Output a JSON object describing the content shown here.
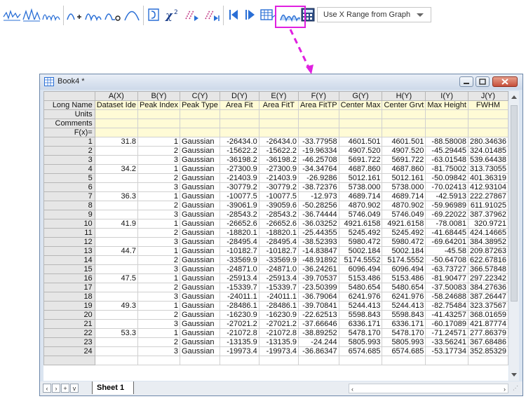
{
  "toolbar": {
    "range_select": {
      "value": "Use X Range from Graph"
    },
    "buttons": [
      "stack-lines-icon",
      "stack-peaks-icon",
      "baseline-peaks-icon",
      "add-peak-icon",
      "peak-shape-icon",
      "remove-peak-icon",
      "peak-bell-icon",
      "integrate-icon",
      "chi-square-icon",
      "fit-until-converge-icon",
      "fit-one-iteration-icon",
      "prev-icon",
      "next-icon",
      "table-icon",
      "find-peaks-icon",
      "calculator-icon"
    ],
    "highlight_color": "#e020e0"
  },
  "window": {
    "title": "Book4 *",
    "sheet_tab": "Sheet 1"
  },
  "columns": [
    "A(X)",
    "B(Y)",
    "C(Y)",
    "D(Y)",
    "E(Y)",
    "F(Y)",
    "G(Y)",
    "H(Y)",
    "I(Y)",
    "J(Y)"
  ],
  "long_names": [
    "Dataset Ide",
    "Peak Index",
    "Peak Type",
    "Area Fit",
    "Area FitT",
    "Area FitTP",
    "Center Max",
    "Center Grvt",
    "Max Height",
    "FWHM"
  ],
  "meta_labels": {
    "long_name": "Long Name",
    "units": "Units",
    "comments": "Comments",
    "fx": "F(x)="
  },
  "rows": [
    [
      "1",
      "31.8",
      "1",
      "Gaussian",
      "-26434.0",
      "-26434.0",
      "-33.77958",
      "4601.501",
      "4601.501",
      "-88.58008",
      "280.34636"
    ],
    [
      "2",
      "",
      "2",
      "Gaussian",
      "-15622.2",
      "-15622.2",
      "-19.96334",
      "4907.520",
      "4907.520",
      "-45.29445",
      "324.01485"
    ],
    [
      "3",
      "",
      "3",
      "Gaussian",
      "-36198.2",
      "-36198.2",
      "-46.25708",
      "5691.722",
      "5691.722",
      "-63.01548",
      "539.64438"
    ],
    [
      "4",
      "34.2",
      "1",
      "Gaussian",
      "-27300.9",
      "-27300.9",
      "-34.34764",
      "4687.860",
      "4687.860",
      "-81.75002",
      "313.73055"
    ],
    [
      "5",
      "",
      "2",
      "Gaussian",
      "-21403.9",
      "-21403.9",
      "-26.9286",
      "5012.161",
      "5012.161",
      "-50.09842",
      "401.36319"
    ],
    [
      "6",
      "",
      "3",
      "Gaussian",
      "-30779.2",
      "-30779.2",
      "-38.72376",
      "5738.000",
      "5738.000",
      "-70.02413",
      "412.93104"
    ],
    [
      "7",
      "36.3",
      "1",
      "Gaussian",
      "-10077.5",
      "-10077.5",
      "-12.973",
      "4689.714",
      "4689.714",
      "-42.5913",
      "222.27867"
    ],
    [
      "8",
      "",
      "2",
      "Gaussian",
      "-39061.9",
      "-39059.6",
      "-50.28256",
      "4870.902",
      "4870.902",
      "-59.96989",
      "611.91025"
    ],
    [
      "9",
      "",
      "3",
      "Gaussian",
      "-28543.2",
      "-28543.2",
      "-36.74444",
      "5746.049",
      "5746.049",
      "-69.22022",
      "387.37962"
    ],
    [
      "10",
      "41.9",
      "1",
      "Gaussian",
      "-26652.6",
      "-26652.6",
      "-36.03252",
      "4921.6158",
      "4921.6158",
      "-78.0081",
      "320.9721"
    ],
    [
      "11",
      "",
      "2",
      "Gaussian",
      "-18820.1",
      "-18820.1",
      "-25.44355",
      "5245.492",
      "5245.492",
      "-41.68445",
      "424.14665"
    ],
    [
      "12",
      "",
      "3",
      "Gaussian",
      "-28495.4",
      "-28495.4",
      "-38.52393",
      "5980.472",
      "5980.472",
      "-69.64201",
      "384.38952"
    ],
    [
      "13",
      "44.7",
      "1",
      "Gaussian",
      "-10182.7",
      "-10182.7",
      "-14.83847",
      "5002.184",
      "5002.184",
      "-45.58",
      "209.87263"
    ],
    [
      "14",
      "",
      "2",
      "Gaussian",
      "-33569.9",
      "-33569.9",
      "-48.91892",
      "5174.5552",
      "5174.5552",
      "-50.64708",
      "622.67816"
    ],
    [
      "15",
      "",
      "3",
      "Gaussian",
      "-24871.0",
      "-24871.0",
      "-36.24261",
      "6096.494",
      "6096.494",
      "-63.73727",
      "366.57848"
    ],
    [
      "16",
      "47.5",
      "1",
      "Gaussian",
      "-25913.4",
      "-25913.4",
      "-39.70537",
      "5153.486",
      "5153.486",
      "-81.90477",
      "297.22342"
    ],
    [
      "17",
      "",
      "2",
      "Gaussian",
      "-15339.7",
      "-15339.7",
      "-23.50399",
      "5480.654",
      "5480.654",
      "-37.50083",
      "384.27636"
    ],
    [
      "18",
      "",
      "3",
      "Gaussian",
      "-24011.1",
      "-24011.1",
      "-36.79064",
      "6241.976",
      "6241.976",
      "-58.24688",
      "387.26447"
    ],
    [
      "19",
      "49.3",
      "1",
      "Gaussian",
      "-28486.1",
      "-28486.1",
      "-39.70841",
      "5244.413",
      "5244.413",
      "-82.75484",
      "323.37567"
    ],
    [
      "20",
      "",
      "2",
      "Gaussian",
      "-16230.9",
      "-16230.9",
      "-22.62513",
      "5598.843",
      "5598.843",
      "-41.43257",
      "368.01659"
    ],
    [
      "21",
      "",
      "3",
      "Gaussian",
      "-27021.2",
      "-27021.2",
      "-37.66646",
      "6336.171",
      "6336.171",
      "-60.17089",
      "421.87774"
    ],
    [
      "22",
      "53.3",
      "1",
      "Gaussian",
      "-21072.8",
      "-21072.8",
      "-38.89252",
      "5478.170",
      "5478.170",
      "-71.24571",
      "277.86379"
    ],
    [
      "23",
      "",
      "2",
      "Gaussian",
      "-13135.9",
      "-13135.9",
      "-24.244",
      "5805.993",
      "5805.993",
      "-33.56241",
      "367.68486"
    ],
    [
      "24",
      "",
      "3",
      "Gaussian",
      "-19973.4",
      "-19973.4",
      "-36.86347",
      "6574.685",
      "6574.685",
      "-53.17734",
      "352.85329"
    ]
  ]
}
